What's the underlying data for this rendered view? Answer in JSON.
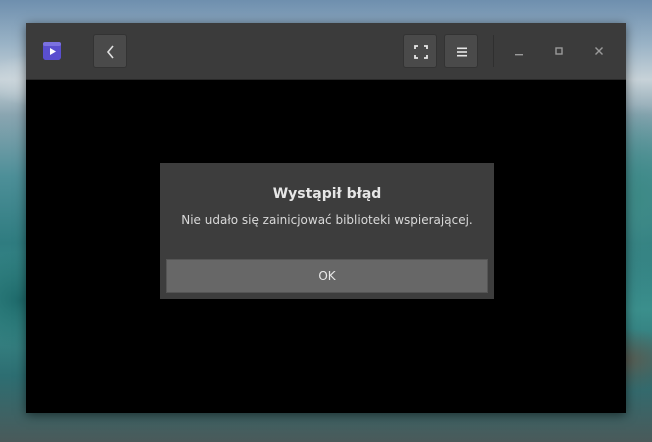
{
  "window": {
    "buttons": {
      "back_icon": "chevron-left-icon",
      "fullscreen_icon": "fullscreen-icon",
      "menu_icon": "hamburger-menu-icon",
      "minimize_icon": "minimize-icon",
      "maximize_icon": "maximize-icon",
      "close_icon": "close-icon"
    },
    "app_icon": "video-player-icon"
  },
  "dialog": {
    "title": "Wystąpił błąd",
    "message": "Nie udało się zainicjować biblioteki wspierającej.",
    "ok_label": "OK"
  },
  "colors": {
    "headerbar": "#3b3b3b",
    "content": "#000000",
    "dialog": "#3d3d3d",
    "dialog_button": "#676767"
  }
}
